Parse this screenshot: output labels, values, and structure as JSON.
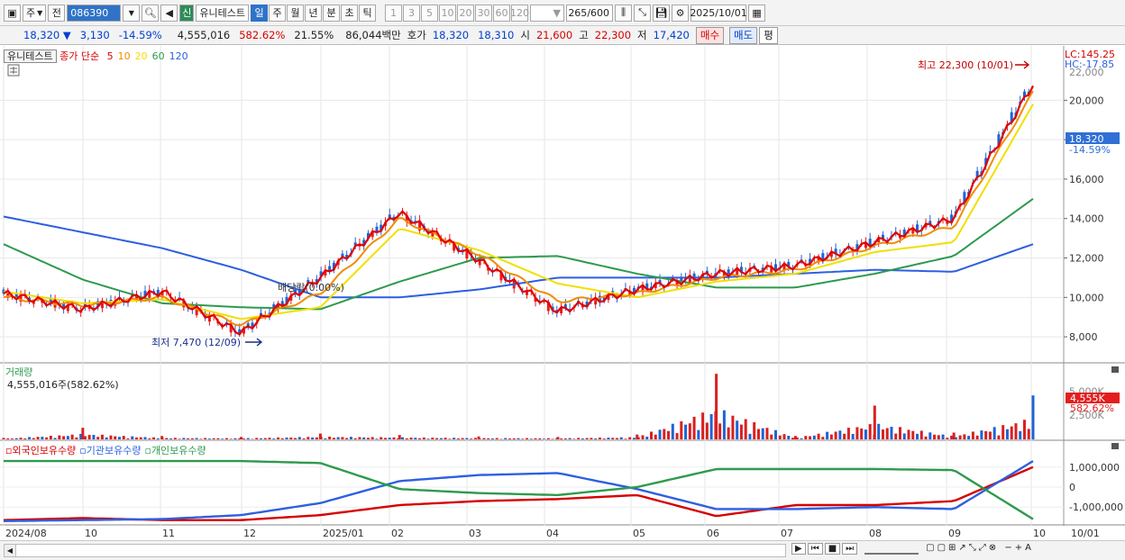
{
  "toolbar": {
    "type_label": "주",
    "prev_label": "전",
    "stock_code": "086390",
    "credit_badge": "신",
    "stock_name": "유니테스트",
    "period_tabs": [
      {
        "label": "일",
        "active": true
      },
      {
        "label": "주",
        "active": false
      },
      {
        "label": "월",
        "active": false
      },
      {
        "label": "년",
        "active": false
      },
      {
        "label": "분",
        "active": false
      },
      {
        "label": "초",
        "active": false
      },
      {
        "label": "틱",
        "active": false
      }
    ],
    "interval_options": [
      "1",
      "3",
      "5",
      "10",
      "20",
      "30",
      "60",
      "120"
    ],
    "count": "265",
    "count_max": "/600",
    "date": "2025/10/01"
  },
  "quote": {
    "price": "18,320",
    "arrow": "▼",
    "change": "3,130",
    "change_pct": "-14.59%",
    "volume": "4,555,016",
    "volume_ratio": "582.62%",
    "turnover": "21.55%",
    "amount": "86,044백만",
    "ask_label": "호가",
    "ask": "18,320",
    "bid": "18,310",
    "open_label": "시",
    "open": "21,600",
    "high_label": "고",
    "high": "22,300",
    "low_label": "저",
    "low": "17,420",
    "buy_label": "매수",
    "sell_label": "매도",
    "eval_label": "평"
  },
  "price_panel": {
    "legend_name": "유니테스트",
    "legend_ma_label": "종가 단순",
    "ma_periods": [
      {
        "label": "5",
        "color": "#e00000"
      },
      {
        "label": "10",
        "color": "#f08c00"
      },
      {
        "label": "20",
        "color": "#f0e000"
      },
      {
        "label": "60",
        "color": "#2e9a4e"
      },
      {
        "label": "120",
        "color": "#2e5fe0"
      }
    ],
    "lc_label": "LC:145.25",
    "hc_label": "HC:-17.85",
    "high_annotation": "최고 22,300 (10/01)",
    "low_annotation": "최저 7,470 (12/09)",
    "dividend_annotation": "배당락(0.00%)",
    "current_price_tag": "18,320",
    "current_pct_tag": "-14.59%",
    "y_ticks": [
      "20,000",
      "18,000",
      "16,000",
      "14,000",
      "12,000",
      "10,000",
      "8,000"
    ],
    "y_tick_partial": "22,000"
  },
  "volume_panel": {
    "title": "거래량",
    "value_label": "4,555,016주(582.62%)",
    "y_ticks": [
      "5,000K",
      "2,500K"
    ],
    "current_tag": "4,555K",
    "current_pct_tag": "582.62%"
  },
  "holdings_panel": {
    "legend": [
      {
        "label": "외국인보유수량",
        "color": "#d60000"
      },
      {
        "label": "기관보유수량",
        "color": "#2e5fe0"
      },
      {
        "label": "개인보유수량",
        "color": "#2e9a4e"
      }
    ],
    "y_ticks": [
      "1,000,000",
      "0",
      "-1,000,000"
    ]
  },
  "x_axis": {
    "labels": [
      "2024/08",
      "10",
      "11",
      "12",
      "2025/01",
      "02",
      "03",
      "04",
      "05",
      "06",
      "07",
      "08",
      "09",
      "10",
      "10/01"
    ]
  },
  "chart_data": [
    {
      "type": "line",
      "title": "",
      "description_series_unit": "KRW",
      "x": [
        "2024/08",
        "10",
        "11",
        "12",
        "2025/01",
        "02",
        "03",
        "04",
        "05",
        "06",
        "07",
        "08",
        "09",
        "10"
      ],
      "ylim": [
        7000,
        22300
      ],
      "series": [
        {
          "name": "5",
          "color": "#e00000",
          "values": [
            10200,
            9400,
            10300,
            8200,
            11000,
            14300,
            11900,
            9300,
            10400,
            11200,
            11600,
            12800,
            14000,
            20800
          ]
        },
        {
          "name": "10",
          "color": "#f08c00",
          "values": [
            10000,
            9600,
            10000,
            8600,
            10200,
            14000,
            12200,
            9800,
            10200,
            11000,
            11400,
            12600,
            13600,
            20400
          ]
        },
        {
          "name": "20",
          "color": "#f0e000",
          "values": [
            10300,
            9700,
            9900,
            8900,
            9500,
            13500,
            12400,
            10700,
            10000,
            10800,
            11200,
            12300,
            12800,
            19800
          ]
        },
        {
          "name": "60",
          "color": "#2e9a4e",
          "values": [
            12700,
            10900,
            9700,
            9500,
            9400,
            10800,
            12000,
            12100,
            11200,
            10500,
            10500,
            11200,
            12100,
            15000
          ]
        },
        {
          "name": "120",
          "color": "#2e5fe0",
          "values": [
            14100,
            13300,
            12500,
            11400,
            10000,
            10000,
            10400,
            11000,
            11000,
            11000,
            11200,
            11400,
            11300,
            12700
          ]
        }
      ]
    },
    {
      "type": "bar",
      "title": "",
      "x": [
        "2024/08",
        "10",
        "11",
        "12",
        "2025/01",
        "02",
        "03",
        "04",
        "05",
        "06",
        "07",
        "08",
        "09",
        "10"
      ],
      "ylim": [
        0,
        7000
      ],
      "values_thousand": [
        150,
        1200,
        350,
        250,
        600,
        450,
        300,
        250,
        500,
        6800,
        350,
        3500,
        700,
        4555
      ]
    },
    {
      "type": "line",
      "title": "",
      "x": [
        "2024/08",
        "10",
        "11",
        "12",
        "2025/01",
        "02",
        "03",
        "04",
        "05",
        "06",
        "07",
        "08",
        "09",
        "10"
      ],
      "ylim": [
        -1800000,
        1800000
      ],
      "series": [
        {
          "name": "외국인보유수량",
          "color": "#d60000",
          "values": [
            -1650000,
            -1550000,
            -1650000,
            -1650000,
            -1400000,
            -900000,
            -700000,
            -600000,
            -400000,
            -1450000,
            -900000,
            -900000,
            -700000,
            1000000
          ]
        },
        {
          "name": "기관보유수량",
          "color": "#2e5fe0",
          "values": [
            -1700000,
            -1650000,
            -1600000,
            -1400000,
            -800000,
            300000,
            600000,
            700000,
            -100000,
            -1100000,
            -1100000,
            -1000000,
            -1100000,
            1300000
          ]
        },
        {
          "name": "개인보유수량",
          "color": "#2e9a4e",
          "values": [
            1300000,
            1300000,
            1300000,
            1300000,
            1200000,
            -100000,
            -300000,
            -400000,
            0,
            900000,
            900000,
            900000,
            850000,
            -1600000
          ]
        }
      ]
    }
  ]
}
